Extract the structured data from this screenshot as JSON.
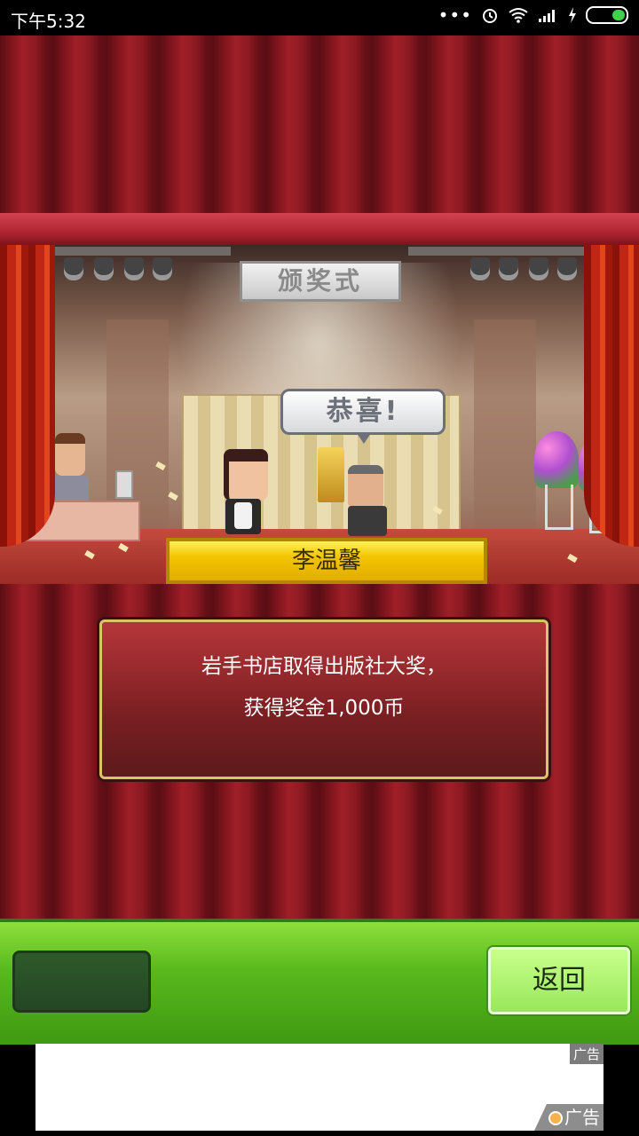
{
  "status_bar": {
    "time": "下午5:32",
    "battery_color": "#3fd14a"
  },
  "stage": {
    "sign_text": "颁奖式",
    "speech_bubble": "恭喜!",
    "winner_name": "李温馨"
  },
  "message": {
    "line1": "岩手书店取得出版社大奖，",
    "line2": "获得奖金1,000币"
  },
  "bottom_bar": {
    "back_label": "返回"
  },
  "ad": {
    "tag_top": "广告",
    "tag_bottom": "广告"
  },
  "colors": {
    "accent_green": "#58b81c",
    "gold": "#f3c400",
    "curtain_red": "#8c1a22"
  }
}
